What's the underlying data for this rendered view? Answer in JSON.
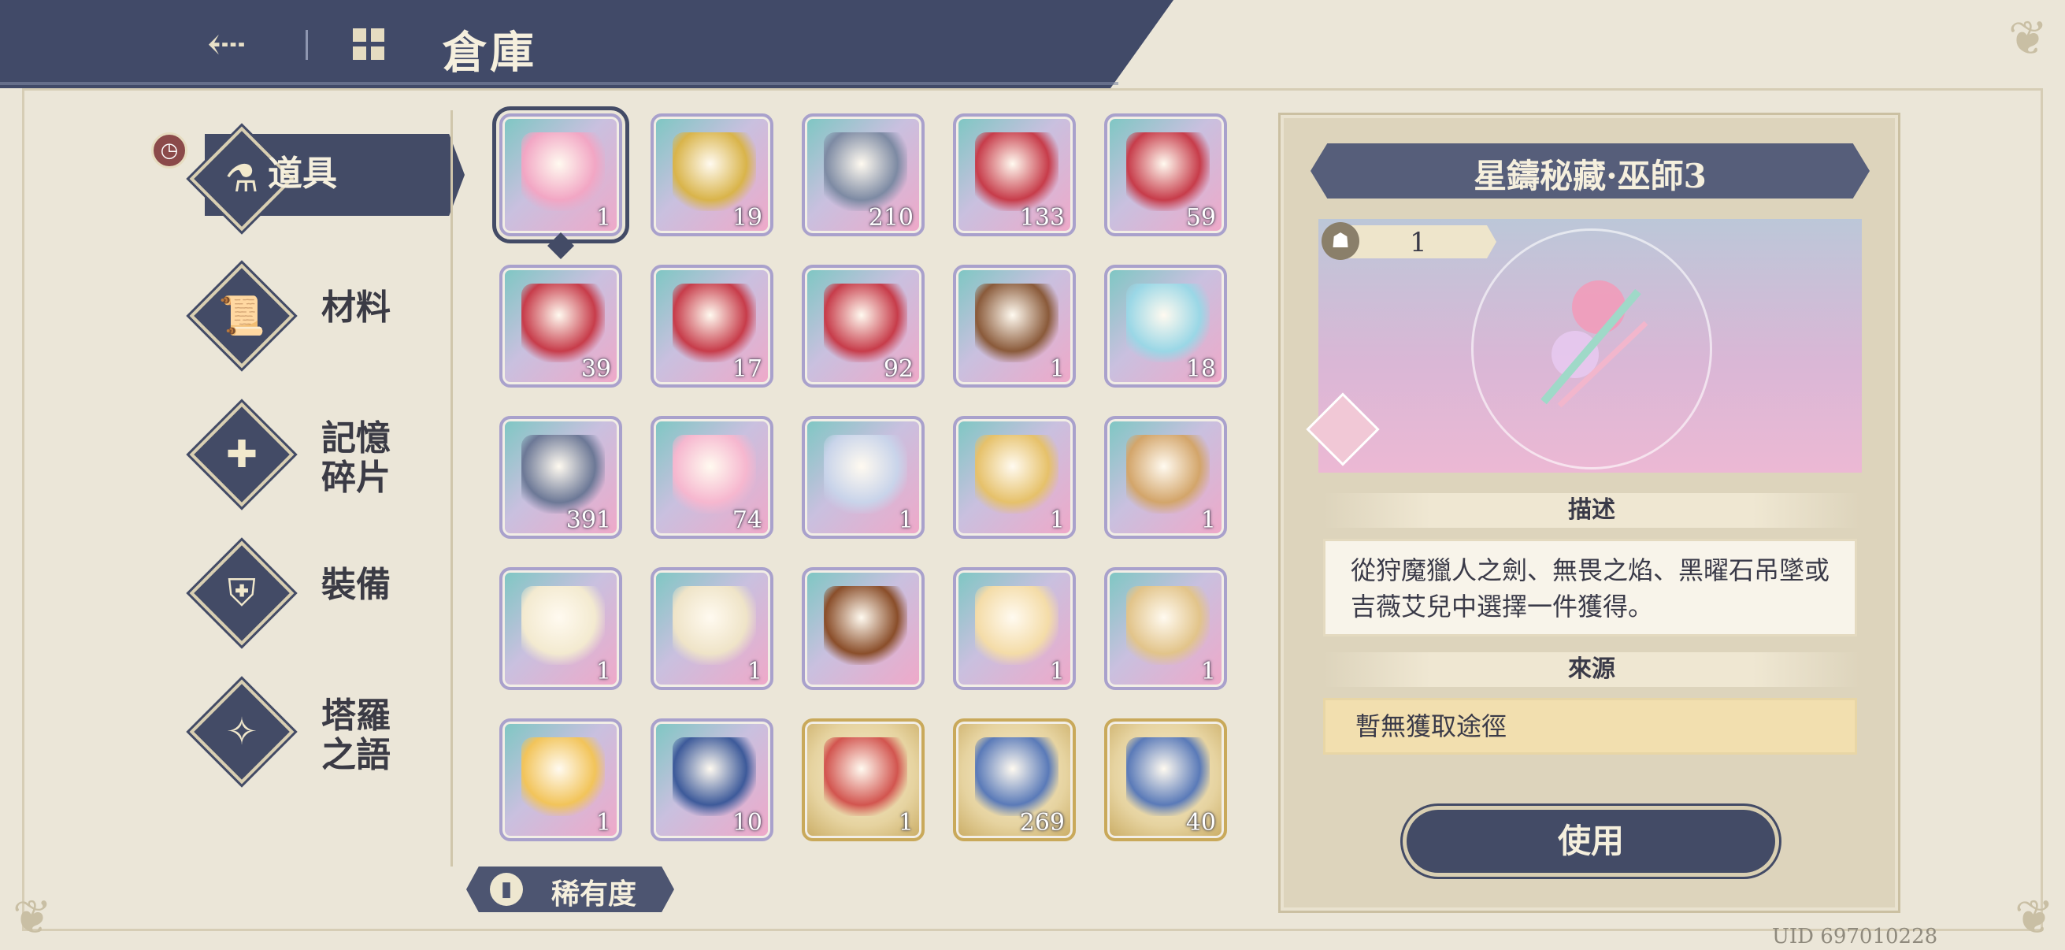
{
  "header": {
    "title": "倉庫"
  },
  "sidebar": {
    "items": [
      {
        "label": "道具",
        "icon": "potion-icon",
        "active": true
      },
      {
        "label": "材料",
        "icon": "scroll-icon",
        "active": false
      },
      {
        "label": "記憶\n碎片",
        "icon": "puzzle-icon",
        "active": false
      },
      {
        "label": "裝備",
        "icon": "armor-icon",
        "active": false
      },
      {
        "label": "塔羅\n之語",
        "icon": "tarot-icon",
        "active": false
      }
    ]
  },
  "inventory": {
    "items": [
      {
        "name": "weapon-bundle",
        "qty": "1",
        "frame": "rainbow"
      },
      {
        "name": "black-gold-chest",
        "qty": "19",
        "frame": "rainbow"
      },
      {
        "name": "crystal-box",
        "qty": "210",
        "frame": "rainbow"
      },
      {
        "name": "red-chest",
        "qty": "133",
        "frame": "rainbow"
      },
      {
        "name": "red-chest",
        "qty": "59",
        "frame": "rainbow"
      },
      {
        "name": "red-chest",
        "qty": "39",
        "frame": "rainbow"
      },
      {
        "name": "red-chest",
        "qty": "17",
        "frame": "rainbow"
      },
      {
        "name": "red-chest",
        "qty": "92",
        "frame": "rainbow"
      },
      {
        "name": "portrait-frame",
        "qty": "1",
        "frame": "rainbow"
      },
      {
        "name": "crystal-cluster",
        "qty": "18",
        "frame": "rainbow"
      },
      {
        "name": "jewel-box",
        "qty": "391",
        "frame": "rainbow"
      },
      {
        "name": "pink-crest",
        "qty": "74",
        "frame": "rainbow"
      },
      {
        "name": "bell-card",
        "qty": "1",
        "frame": "rainbow"
      },
      {
        "name": "crystal-laurel",
        "qty": "1",
        "frame": "rainbow"
      },
      {
        "name": "red-letter",
        "qty": "1",
        "frame": "rainbow"
      },
      {
        "name": "green-letter",
        "qty": "1",
        "frame": "rainbow"
      },
      {
        "name": "quill-letter",
        "qty": "1",
        "frame": "rainbow"
      },
      {
        "name": "ornate-book",
        "qty": "",
        "frame": "rainbow"
      },
      {
        "name": "feather-scroll",
        "qty": "1",
        "frame": "rainbow"
      },
      {
        "name": "lantern-feather",
        "qty": "1",
        "frame": "rainbow"
      },
      {
        "name": "flame-feather",
        "qty": "1",
        "frame": "rainbow"
      },
      {
        "name": "grail-card",
        "qty": "10",
        "frame": "rainbow"
      },
      {
        "name": "octopus-shell",
        "qty": "1",
        "frame": "gold"
      },
      {
        "name": "blue-chest",
        "qty": "269",
        "frame": "gold"
      },
      {
        "name": "blue-chest",
        "qty": "40",
        "frame": "gold"
      }
    ]
  },
  "rarity_filter": {
    "label": "稀有度"
  },
  "detail": {
    "title": "星鑄秘藏·巫師3",
    "owned": "1",
    "description_heading": "描述",
    "description": "從狩魔獵人之劍、無畏之焰、黑曜石吊墜或吉薇艾兒中選擇一件獲得。",
    "source_heading": "來源",
    "source": "暫無獲取途徑",
    "use_label": "使用"
  },
  "uid": "UID 697010228",
  "colors": {
    "navy": "#434b66",
    "parchment": "#ebe6d8",
    "panel": "#ddd4bc",
    "gold": "#f2dfaf"
  }
}
